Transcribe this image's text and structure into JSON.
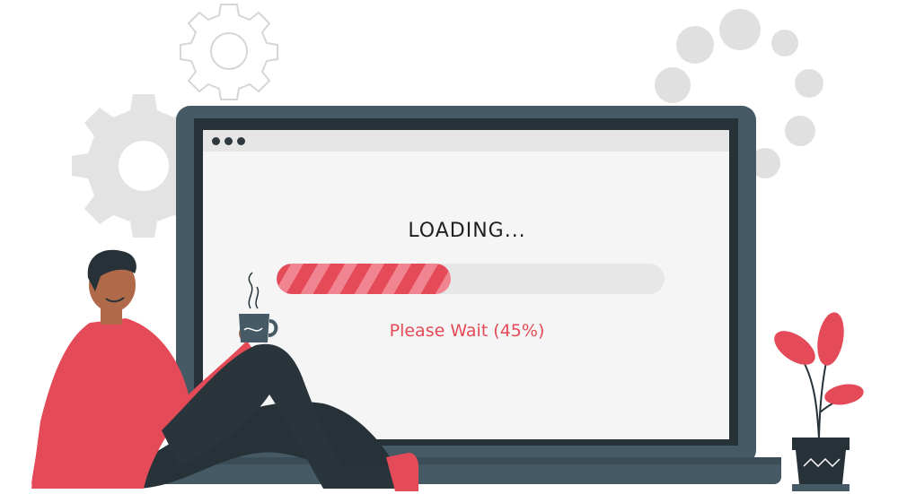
{
  "screen": {
    "loading_label": "LOADING...",
    "wait_label": "Please Wait (45%)",
    "progress_fraction": 0.45
  },
  "colors": {
    "accent": "#e44a57",
    "laptop_frame": "#455a64",
    "screen_bg": "#f5f5f5",
    "track": "#e7e7e7",
    "decor_gray": "#e0e0e0"
  },
  "icons": [
    "gear-icon",
    "loading-dots-icon",
    "coffee-mug-icon",
    "plant-icon",
    "window-dots-icon"
  ]
}
